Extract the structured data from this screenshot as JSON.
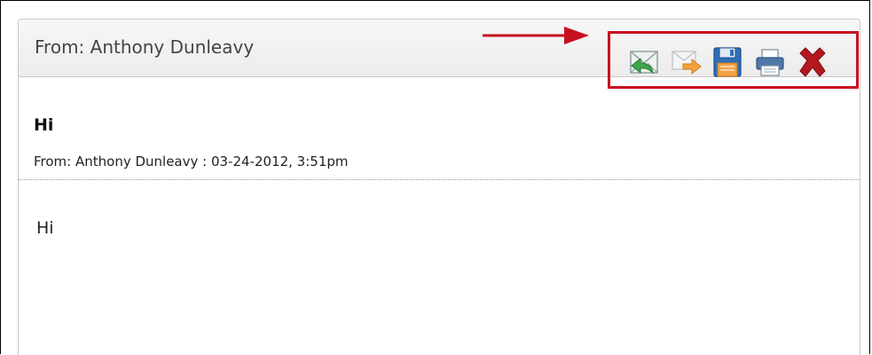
{
  "header": {
    "title": "From: Anthony Dunleavy"
  },
  "toolbar": {
    "buttons": [
      {
        "name": "reply",
        "icon": "reply-mail-icon"
      },
      {
        "name": "forward",
        "icon": "forward-mail-icon"
      },
      {
        "name": "save",
        "icon": "floppy-disk-icon"
      },
      {
        "name": "print",
        "icon": "printer-icon"
      },
      {
        "name": "delete",
        "icon": "red-x-close-icon"
      }
    ],
    "highlight_color": "#c8101f"
  },
  "message": {
    "subject": "Hi",
    "meta": "From: Anthony Dunleavy : 03-24-2012, 3:51pm",
    "body": "Hi"
  },
  "annotation": {
    "arrow_color": "#c8101f"
  }
}
